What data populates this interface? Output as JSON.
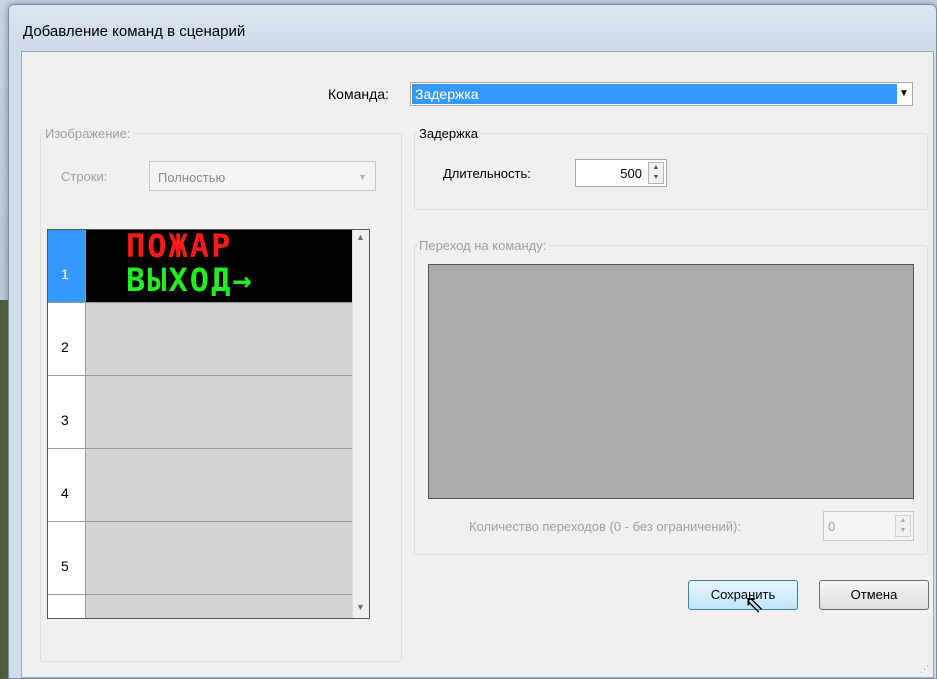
{
  "window": {
    "title": "Добавление команд в сценарий"
  },
  "command": {
    "label": "Команда:",
    "value": "Задержка"
  },
  "image_group": {
    "legend": "Изображение:",
    "rows_label": "Строки:",
    "rows_value": "Полностью",
    "rows": [
      {
        "num": "1",
        "line1": "ПОЖАР",
        "line2": "ВЫХОД→",
        "selected": true
      },
      {
        "num": "2"
      },
      {
        "num": "3"
      },
      {
        "num": "4"
      },
      {
        "num": "5"
      }
    ]
  },
  "delay_group": {
    "legend": "Задержка",
    "duration_label": "Длительность:",
    "duration_value": "500"
  },
  "jump_group": {
    "legend": "Переход на команду:",
    "count_label": "Количество переходов (0 - без ограничений):",
    "count_value": "0"
  },
  "buttons": {
    "save": "Сохранить",
    "cancel": "Отмена"
  },
  "colors": {
    "selection": "#3399ff",
    "led_red": "#ff1a1a",
    "led_green": "#22ee22"
  }
}
